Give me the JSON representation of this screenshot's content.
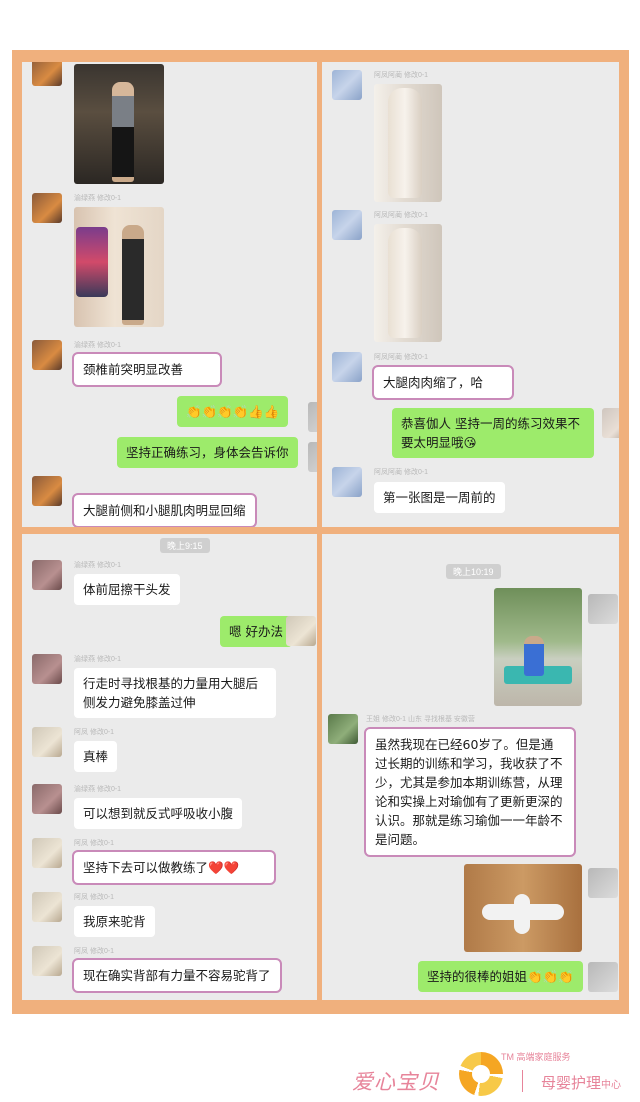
{
  "panel1": {
    "nick_1": "",
    "nick_2": "渝绿燕 修改0-1",
    "nick_3": "渝绿燕 修改0-1",
    "msg_1": "颈椎前突明显改善",
    "msg_2": "👏👏👏👏👍👍",
    "msg_3": "坚持正确练习，身体会告诉你",
    "msg_4": "大腿前侧和小腿肌肉明显回缩"
  },
  "panel2": {
    "nick_1": "阿凤阿蔺 修改0-1",
    "nick_2": "阿凤阿蔺 修改0-1",
    "nick_3": "阿凤阿蔺 修改0-1",
    "nick_4": "阿凤阿蔺 修改0-1",
    "msg_1": "大腿肉肉缩了，哈",
    "msg_2": "恭喜伽人 坚持一周的练习效果不要太明显哦😘",
    "msg_3": "第一张图是一周前的"
  },
  "panel3": {
    "timestamp": "晚上9:15",
    "nick_1": "渝绿燕 修改0-1",
    "nick_2": "渝绿燕 修改0-1",
    "nick_3": "阿凤 修改0-1",
    "nick_4": "渝绿燕 修改0-1",
    "nick_5": "阿凤 修改0-1",
    "nick_6": "阿凤 修改0-1",
    "nick_7": "阿凤 修改0-1",
    "msg_1": "体前屈擦干头发",
    "msg_2": "嗯 好办法",
    "msg_3": "行走时寻找根基的力量用大腿后侧发力避免膝盖过伸",
    "msg_4": "真棒",
    "msg_5": "可以想到就反式呼吸收小腹",
    "msg_6": "坚持下去可以做教练了❤️❤️",
    "msg_7": "我原来驼背",
    "msg_8": "现在确实背部有力量不容易驼背了"
  },
  "panel4": {
    "timestamp": "晚上10:19",
    "nick_1": "王姐 修改0-1 山东 寻找根基 安徽营",
    "msg_1": "虽然我现在已经60岁了。但是通过长期的训练和学习，我收获了不少，尤其是参加本期训练营，从理论和实操上对瑜伽有了更新更深的认识。那就是练习瑜伽一一年龄不是问题。",
    "msg_2": "坚持的很棒的姐姐👏👏👏"
  },
  "footer": {
    "brand": "爱心宝贝",
    "tm": "TM 高端家庭服务",
    "sub": "母婴护理",
    "sub_small": "中心"
  },
  "colors": {
    "frame": "#f0b07d",
    "panel_bg": "#ebebeb",
    "green_bubble": "#9deb6b",
    "highlight_box": "#c98ab9",
    "brand": "#e7849a"
  },
  "icons": [
    "avatar",
    "photo",
    "logo-icon"
  ]
}
